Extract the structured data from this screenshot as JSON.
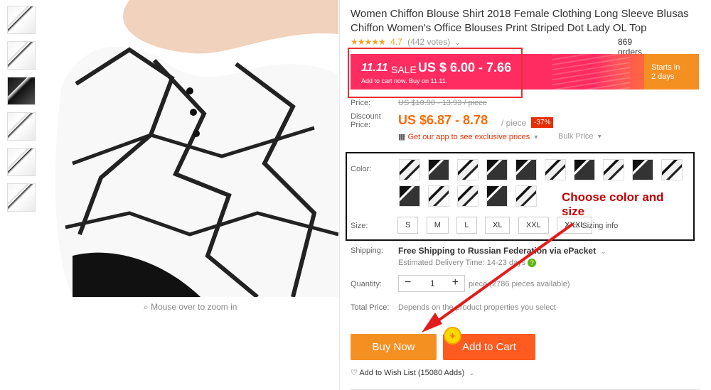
{
  "product": {
    "title": "Women Chiffon Blouse Shirt 2018 Female Clothing Long Sleeve Blusas Chiffon Women's Office Blouses Print Striped Dot Lady OL Top",
    "rating": "4.7",
    "votes": "(442 votes)",
    "orders": "869 orders",
    "stars": "★★★★★"
  },
  "sale": {
    "logo": "11.11",
    "word": "SALE",
    "price": "US $ 6.00 - 7.66",
    "subtext": "Add to cart now. Buy on 11.11.",
    "starts_label": "Starts in",
    "starts_value": "2 days"
  },
  "pricing": {
    "price_label": "Price:",
    "old_price": "US $10.90 - 13.93 / piece",
    "discount_label": "Discount Price:",
    "discount_price": "US $6.87 - 8.78",
    "per_piece": "/ piece",
    "discount_percent": "-37%",
    "app_link": "Get our app to see exclusive prices",
    "bulk": "Bulk Price"
  },
  "options": {
    "color_label": "Color:",
    "size_label": "Size:",
    "sizes": [
      "S",
      "M",
      "L",
      "XL",
      "XXL",
      "XXXL"
    ],
    "sizing_info": "Sizing info",
    "annotation": "Choose color and size"
  },
  "shipping": {
    "label": "Shipping:",
    "text": "Free Shipping to Russian Federation via ePacket",
    "estimate": "Estimated Delivery Time: 14-23 days"
  },
  "quantity": {
    "label": "Quantity:",
    "value": "1",
    "minus": "−",
    "plus": "+",
    "stock": "piece (2786 pieces available)"
  },
  "total": {
    "label": "Total Price:",
    "note": "Depends on the product properties you select"
  },
  "actions": {
    "buy_now": "Buy Now",
    "add_to_cart": "Add to Cart",
    "wishlist": "Add to Wish List (15080 Adds)"
  },
  "zoom_hint": "Mouse over to zoom in",
  "colors": {
    "accent": "#ff6a00",
    "sale": "#ff2c61",
    "annotation_red": "#e21b1b"
  }
}
